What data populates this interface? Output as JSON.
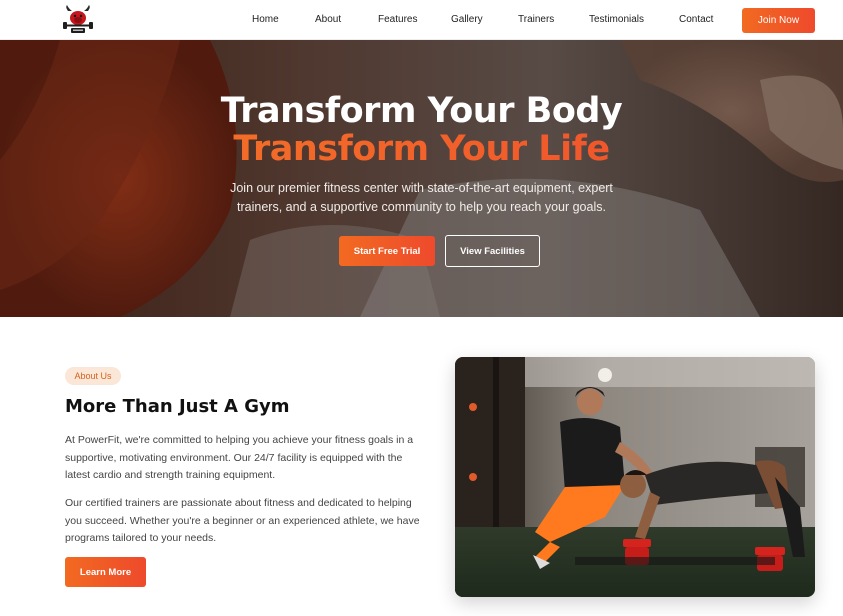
{
  "nav": {
    "logo_icon": "gym-bull-logo-icon",
    "links": [
      "Home",
      "About",
      "Features",
      "Gallery",
      "Trainers",
      "Testimonials",
      "Contact"
    ],
    "cta": "Join Now"
  },
  "hero": {
    "title_line1": "Transform Your Body",
    "title_line2": "Transform Your Life",
    "subtitle": "Join our premier fitness center with state-of-the-art equipment, expert trainers, and a supportive community to help you reach your goals.",
    "primary_button": "Start Free Trial",
    "secondary_button": "View Facilities"
  },
  "about": {
    "badge": "About Us",
    "title": "More Than Just A Gym",
    "paragraph1": "At PowerFit, we're committed to helping you achieve your fitness goals in a supportive, motivating environment. Our 24/7 facility is equipped with the latest cardio and strength training equipment.",
    "paragraph2": "Our certified trainers are passionate about fitness and dedicated to helping you succeed. Whether you're a beginner or an experienced athlete, we have programs tailored to your needs.",
    "button": "Learn More"
  },
  "colors": {
    "accent": "#f26a21",
    "accent_end": "#ee4a2c",
    "badge_bg": "#fbe7d7"
  }
}
